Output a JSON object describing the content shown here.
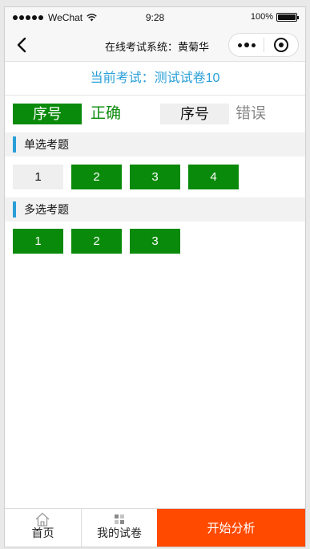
{
  "status_bar": {
    "carrier": "WeChat",
    "time": "9:28",
    "battery": "100%",
    "battery_level": 1.0
  },
  "nav": {
    "title": "在线考试系统：黄菊华"
  },
  "current_exam": "当前考试：测试试卷10",
  "legend": {
    "correct_box": "序号",
    "correct_label": "正确",
    "wrong_box": "序号",
    "wrong_label": "错误"
  },
  "sections": [
    {
      "title": "单选考题",
      "questions": [
        {
          "num": "1",
          "status": "wrong"
        },
        {
          "num": "2",
          "status": "correct"
        },
        {
          "num": "3",
          "status": "correct"
        },
        {
          "num": "4",
          "status": "correct"
        }
      ]
    },
    {
      "title": "多选考题",
      "questions": [
        {
          "num": "1",
          "status": "correct"
        },
        {
          "num": "2",
          "status": "correct"
        },
        {
          "num": "3",
          "status": "correct"
        }
      ]
    }
  ],
  "tabbar": {
    "home": "首页",
    "my_papers": "我的试卷",
    "start_analysis": "开始分析"
  },
  "colors": {
    "accent_blue": "#2a9fd8",
    "correct_green": "#0a8a0a",
    "wrong_gray": "#efefef",
    "action_orange": "#ff4a00"
  }
}
